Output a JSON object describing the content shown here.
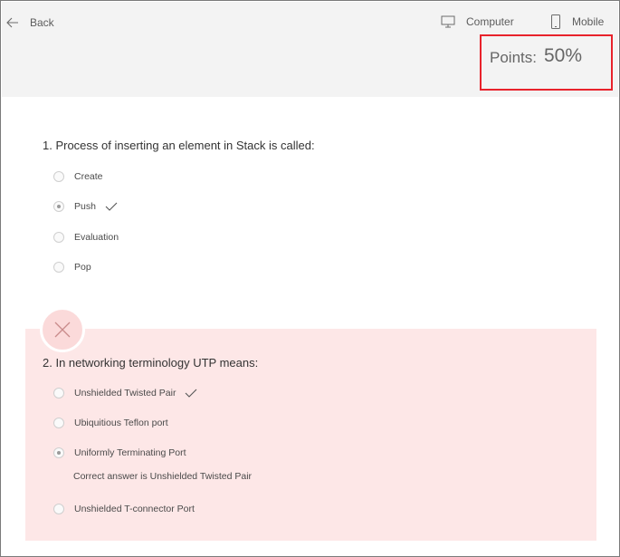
{
  "header": {
    "back_label": "Back",
    "computer_label": "Computer",
    "mobile_label": "Mobile",
    "points_label": "Points:",
    "points_value": "50%"
  },
  "questions": [
    {
      "title": "1. Process of inserting an element in Stack is called:",
      "options": [
        {
          "label": "Create",
          "selected": false,
          "correct": false
        },
        {
          "label": "Push",
          "selected": true,
          "correct": true
        },
        {
          "label": "Evaluation",
          "selected": false,
          "correct": false
        },
        {
          "label": "Pop",
          "selected": false,
          "correct": false
        }
      ]
    },
    {
      "title": "2. In networking terminology UTP means:",
      "result": "incorrect",
      "options": [
        {
          "label": "Unshielded Twisted Pair",
          "selected": false,
          "correct": true
        },
        {
          "label": "Ubiquitious Teflon port",
          "selected": false,
          "correct": false
        },
        {
          "label": "Uniformly Terminating Port",
          "selected": true,
          "correct": false
        },
        {
          "label": "Unshielded T-connector Port",
          "selected": false,
          "correct": false
        }
      ],
      "feedback": "Correct answer is Unshielded Twisted Pair"
    }
  ],
  "colors": {
    "highlight_border": "#e8222b",
    "wrong_panel": "#fde7e7",
    "header_bg": "#f3f3f3"
  }
}
